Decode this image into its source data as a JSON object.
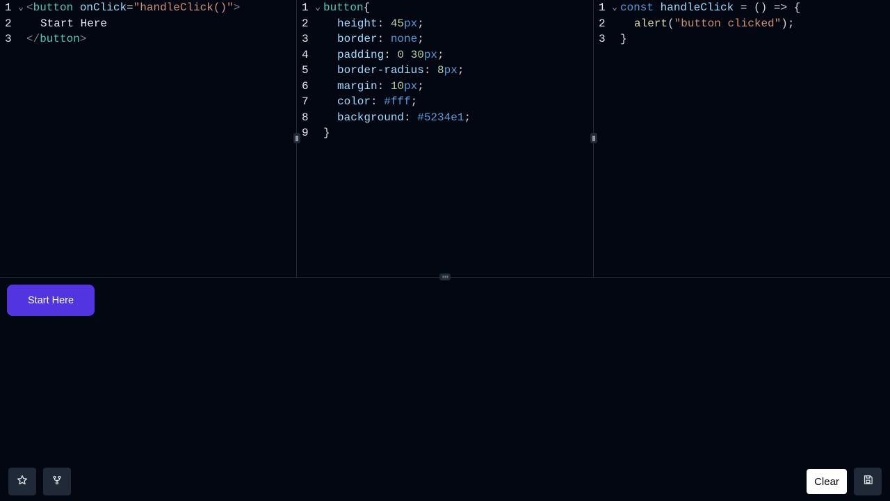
{
  "html_editor": {
    "lines": [
      {
        "num": "1",
        "foldable": true
      },
      {
        "num": "2",
        "foldable": false
      },
      {
        "num": "3",
        "foldable": false
      }
    ],
    "open_lt": "<",
    "tag": "button",
    "attr_name": "onClick",
    "eq": "=",
    "attr_value": "\"handleClick()\"",
    "open_gt": ">",
    "text": "Start Here",
    "close_lt": "</",
    "close_gt": ">"
  },
  "css_editor": {
    "lines": [
      "1",
      "2",
      "3",
      "4",
      "5",
      "6",
      "7",
      "8",
      "9"
    ],
    "selector": "button",
    "open_brace": "{",
    "close_brace": "}",
    "decls": [
      {
        "prop": "height",
        "value": "45",
        "unit": "px"
      },
      {
        "prop": "border",
        "value": "none",
        "unit": ""
      },
      {
        "prop": "padding",
        "value": "0 30",
        "unit": "px"
      },
      {
        "prop": "border-radius",
        "value": "8",
        "unit": "px"
      },
      {
        "prop": "margin",
        "value": "10",
        "unit": "px"
      },
      {
        "prop": "color",
        "value": "#fff",
        "unit": ""
      },
      {
        "prop": "background",
        "value": "#5234e1",
        "unit": ""
      }
    ]
  },
  "js_editor": {
    "lines": [
      "1",
      "2",
      "3"
    ],
    "kw": "const",
    "name": "handleClick",
    "arrow": " = () => {",
    "fn": "alert",
    "arg": "\"button clicked\"",
    "call_end": ");",
    "close": "}"
  },
  "preview": {
    "button_label": "Start Here"
  },
  "toolbar": {
    "clear_label": "Clear"
  },
  "colors": {
    "background": "#030712",
    "accent": "#5234e1",
    "panel_button": "#1f2937"
  },
  "icons": {
    "star": "star-icon",
    "fork": "fork-icon",
    "save": "save-icon"
  }
}
